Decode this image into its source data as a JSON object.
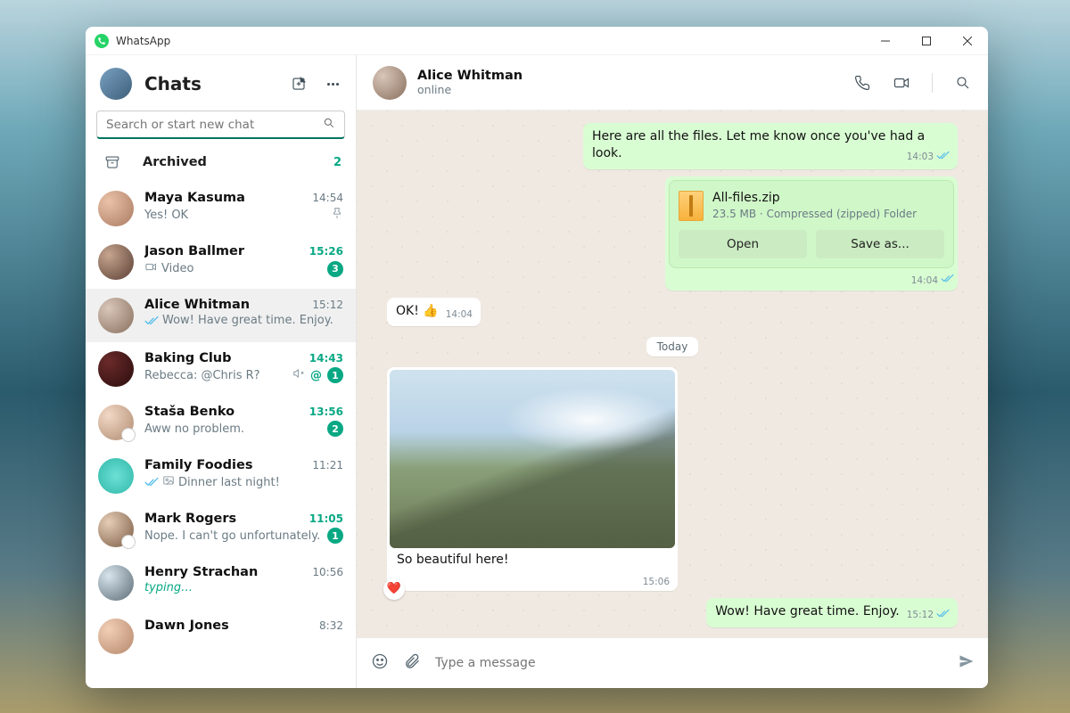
{
  "window": {
    "title": "WhatsApp"
  },
  "sidebar": {
    "heading": "Chats",
    "search_placeholder": "Search or start new chat",
    "archived_label": "Archived",
    "archived_count": "2",
    "chats": [
      {
        "name": "Maya Kasuma",
        "time": "14:54",
        "preview": "Yes! OK",
        "unread": false,
        "pinned": true
      },
      {
        "name": "Jason Ballmer",
        "time": "15:26",
        "preview": "Video",
        "unread": true,
        "badge": "3",
        "video": true
      },
      {
        "name": "Alice Whitman",
        "time": "15:12",
        "preview": "Wow! Have great time. Enjoy.",
        "unread": false,
        "selected": true,
        "ticks": "read"
      },
      {
        "name": "Baking Club",
        "time": "14:43",
        "preview": "Rebecca: @Chris R?",
        "unread": true,
        "badge": "1",
        "muted": true,
        "mention": true
      },
      {
        "name": "Staša Benko",
        "time": "13:56",
        "preview": "Aww no problem.",
        "unread": true,
        "badge": "2"
      },
      {
        "name": "Family Foodies",
        "time": "11:21",
        "preview": "Dinner last night!",
        "unread": false,
        "ticks": "read",
        "photo": true
      },
      {
        "name": "Mark Rogers",
        "time": "11:05",
        "preview": "Nope. I can't go unfortunately.",
        "unread": true,
        "badge": "1"
      },
      {
        "name": "Henry Strachan",
        "time": "10:56",
        "preview": "typing…",
        "typing": true
      },
      {
        "name": "Dawn Jones",
        "time": "8:32",
        "preview": ""
      }
    ]
  },
  "conversation": {
    "title": "Alice Whitman",
    "subtitle": "online",
    "day_label": "Today",
    "composer_placeholder": "Type a message",
    "messages": {
      "m1": {
        "text": "Here are all the files. Let me know once you've had a look.",
        "time": "14:03"
      },
      "file": {
        "name": "All-files.zip",
        "meta": "23.5 MB · Compressed (zipped) Folder",
        "open": "Open",
        "save": "Save as...",
        "time": "14:04"
      },
      "m2": {
        "text": "OK! 👍",
        "time": "14:04"
      },
      "photo": {
        "caption": "So beautiful here!",
        "time": "15:06"
      },
      "m3": {
        "text": "Wow! Have great time. Enjoy.",
        "time": "15:12"
      }
    }
  }
}
